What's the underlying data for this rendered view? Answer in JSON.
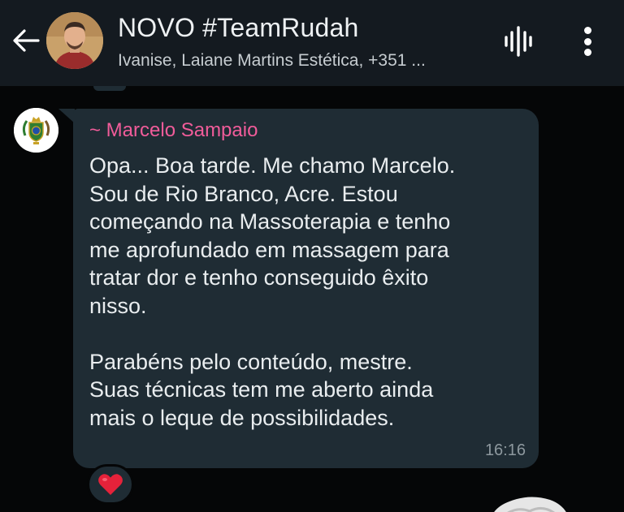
{
  "header": {
    "title": "NOVO #TeamRudah",
    "subtitle": "Ivanise, Laiane Martins Estética, +351 ...",
    "back_icon": "arrow-left-icon",
    "voice_icon": "voice-chat-icon",
    "menu_icon": "more-vertical-icon"
  },
  "message": {
    "sender": "~ Marcelo Sampaio",
    "sender_color": "#f15c9a",
    "lines": [
      "Opa... Boa tarde. Me chamo Marcelo.",
      "Sou de Rio Branco, Acre. Estou",
      "começando na Massoterapia e tenho",
      "me aprofundado em massagem para",
      "tratar dor e tenho conseguido êxito",
      "nisso."
    ],
    "lines2": [
      "Parabéns pelo conteúdo, mestre.",
      "Suas técnicas tem me aberto ainda",
      "mais o leque de possibilidades."
    ],
    "time": "16:16",
    "reaction": "❤️"
  },
  "colors": {
    "header_bg": "#141a20",
    "chat_bg": "#050607",
    "bubble_bg": "#1f2c34",
    "text": "#e9edef",
    "time": "#8d989e"
  }
}
